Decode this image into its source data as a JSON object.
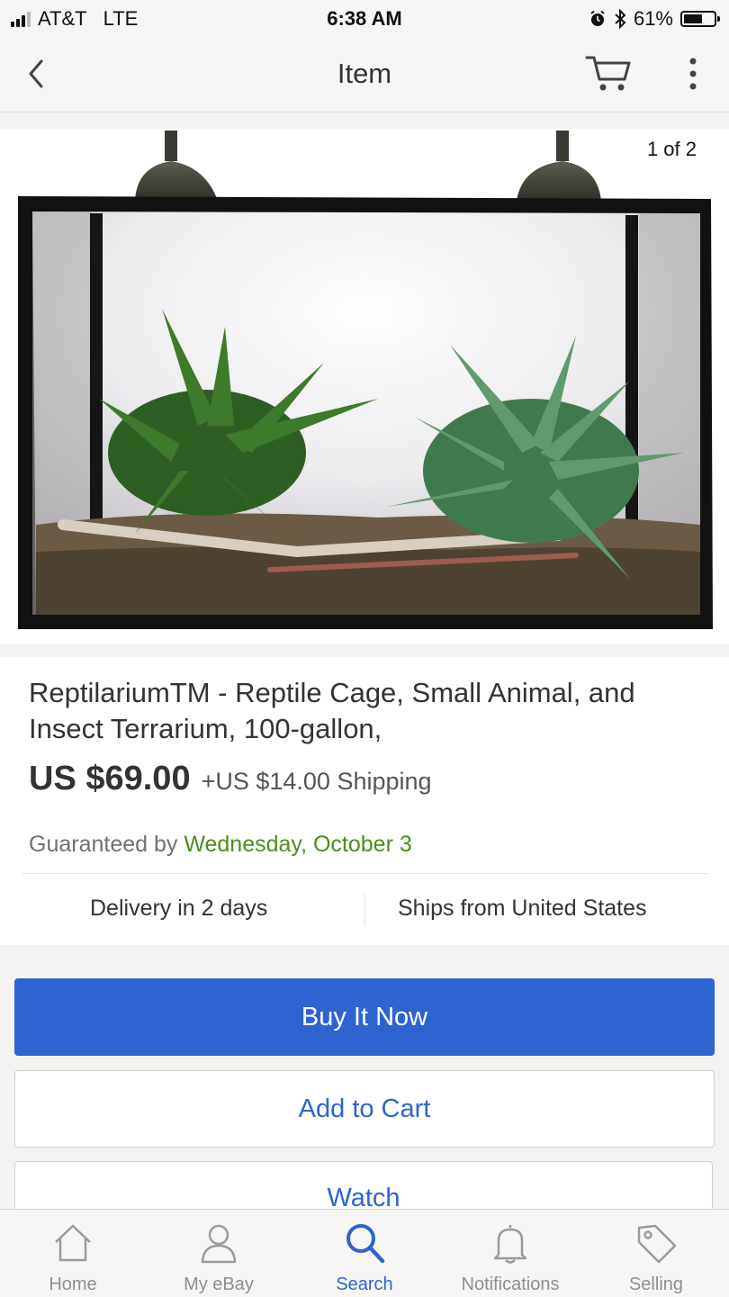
{
  "status_bar": {
    "carrier": "AT&T",
    "network": "LTE",
    "time": "6:38 AM",
    "battery_percent": "61%",
    "battery_level": 0.61
  },
  "nav": {
    "title": "Item",
    "icons": [
      "chevron-left-icon",
      "cart-icon",
      "more-vertical-icon"
    ]
  },
  "photo": {
    "counter": "1 of 2"
  },
  "item": {
    "title": "ReptilariumTM  - Reptile Cage, Small Animal, and Insect Terrarium, 100-gallon,",
    "price": "US $69.00",
    "shipping": "+US $14.00 Shipping",
    "guarantee_label": "Guaranteed by",
    "guarantee_date": "Wednesday, October 3",
    "delivery": "Delivery in 2 days",
    "ships_from": "Ships from United States"
  },
  "actions": {
    "buy_now": "Buy It Now",
    "add_to_cart": "Add to Cart",
    "watch": "Watch"
  },
  "tabs": [
    {
      "label": "Home",
      "icon": "home-icon"
    },
    {
      "label": "My eBay",
      "icon": "user-icon"
    },
    {
      "label": "Search",
      "icon": "search-icon",
      "active": true
    },
    {
      "label": "Notifications",
      "icon": "bell-icon"
    },
    {
      "label": "Selling",
      "icon": "tag-icon"
    }
  ],
  "colors": {
    "accent": "#2d64cf",
    "guarantee_date": "#4d8c1f"
  }
}
